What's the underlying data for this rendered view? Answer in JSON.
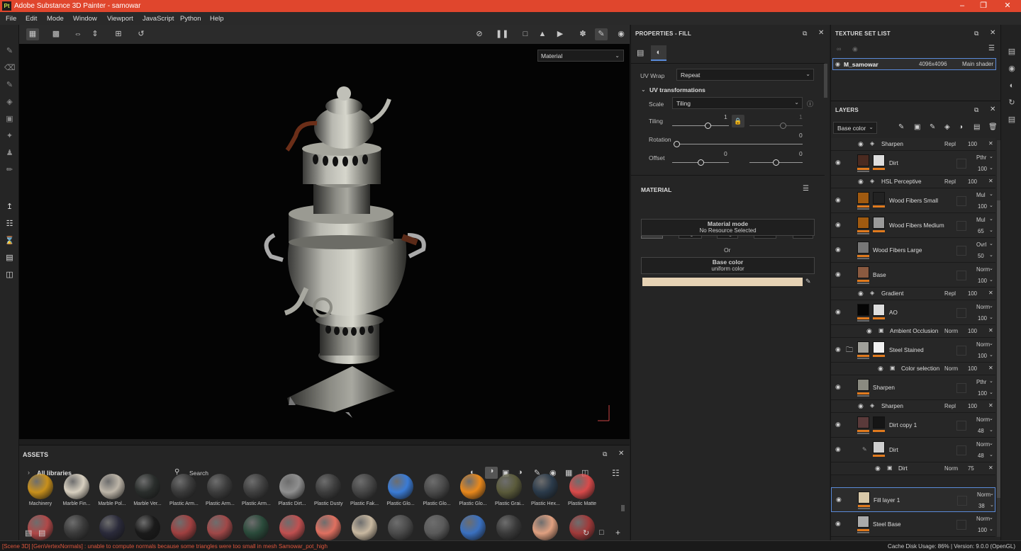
{
  "window": {
    "title": "Adobe Substance 3D Painter - samowar",
    "app_icon": "Pt"
  },
  "menu": [
    "File",
    "Edit",
    "Mode",
    "Window",
    "Viewport",
    "JavaScript",
    "Python",
    "Help"
  ],
  "viewport": {
    "mode_dropdown": "Material"
  },
  "properties": {
    "title": "PROPERTIES - FILL",
    "uv_wrap_label": "UV Wrap",
    "uv_wrap_value": "Repeat",
    "uv_transform_title": "UV transformations",
    "scale_label": "Scale",
    "scale_value": "Tiling",
    "tiling_label": "Tiling",
    "tiling_value": "1",
    "tiling_value2": "1",
    "rotation_label": "Rotation",
    "rotation_value": "0",
    "offset_label": "Offset",
    "offset_x": "0",
    "offset_y": "0",
    "material_title": "MATERIAL",
    "channels": [
      "color",
      "height",
      "rough",
      "metal",
      "nrm"
    ],
    "material_mode_title": "Material mode",
    "material_mode_sub": "No Resource Selected",
    "or_text": "Or",
    "base_color_title": "Base color",
    "base_color_sub": "uniform color",
    "base_color_swatch": "#e6d2b4"
  },
  "texture_set_list": {
    "title": "TEXTURE SET LIST",
    "item_name": "M_samowar",
    "item_res": "4096x4096",
    "item_shader": "Main shader"
  },
  "layers": {
    "title": "LAYERS",
    "channel_dropdown": "Base color",
    "rows": [
      {
        "name": "Sharpen",
        "blend": "Repl",
        "opacity": "100"
      },
      {
        "name": "Dirt",
        "blend": "Pthr",
        "opacity": "100"
      },
      {
        "name": "HSL Perceptive",
        "blend": "Repl",
        "opacity": "100"
      },
      {
        "name": "Wood Fibers Small",
        "blend": "Mul",
        "opacity": "100"
      },
      {
        "name": "Wood Fibers Medium",
        "blend": "Mul",
        "opacity": "65"
      },
      {
        "name": "Wood Fibers Large",
        "blend": "Ovrl",
        "opacity": "50"
      },
      {
        "name": "Base",
        "blend": "Norm",
        "opacity": "100"
      },
      {
        "name": "Gradient",
        "blend": "Repl",
        "opacity": "100"
      },
      {
        "name": "AO",
        "blend": "Norm",
        "opacity": "100"
      },
      {
        "name": "Ambient Occlusion",
        "blend": "Norm",
        "opacity": "100"
      },
      {
        "name": "Steel Stained",
        "blend": "Norm",
        "opacity": "100"
      },
      {
        "name": "Color selection",
        "blend": "Norm",
        "opacity": "100"
      },
      {
        "name": "Sharpen",
        "blend": "Pthr",
        "opacity": "100"
      },
      {
        "name": "Sharpen",
        "blend": "Repl",
        "opacity": "100"
      },
      {
        "name": "Dirt copy 1",
        "blend": "Norm",
        "opacity": "48"
      },
      {
        "name": "Dirt",
        "blend": "Norm",
        "opacity": "48"
      },
      {
        "name": "Dirt",
        "blend": "Norm",
        "opacity": "75"
      },
      {
        "name": "Fill layer 1",
        "blend": "Norm",
        "opacity": "38"
      },
      {
        "name": "Steel Base",
        "blend": "Norm",
        "opacity": "100"
      }
    ]
  },
  "assets": {
    "title": "ASSETS",
    "library": "All libraries",
    "search_placeholder": "Search",
    "materials": [
      "Machinery",
      "Marble Fin...",
      "Marble Pol...",
      "Marble Ver...",
      "Plastic Arm...",
      "Plastic Arm...",
      "Plastic Arm...",
      "Plastic Dirt...",
      "Plastic Dusty",
      "Plastic Fak...",
      "Plastic Glo...",
      "Plastic Glo...",
      "Plastic Glo...",
      "Plastic Grai...",
      "Plastic Hex...",
      "Plastic Matte"
    ],
    "material_colors": [
      "#c8901c",
      "#d8d0c0",
      "#bdb5a8",
      "#2a2e2c",
      "#3a3a3a",
      "#3c3c3c",
      "#3f3f3f",
      "#8f8f8f",
      "#3d3d3d",
      "#454545",
      "#3a7bd5",
      "#4a4a4a",
      "#e8881c",
      "#5a5a3a",
      "#2a3a4a",
      "#d84a4a"
    ],
    "row2_colors": [
      "#b04848",
      "#3a3a3a",
      "#2a2a3a",
      "#1a1a1a",
      "#a04040",
      "#a04848",
      "#2a4a3a",
      "#c05050",
      "#e07060",
      "#c8b8a0",
      "#4a4a4a",
      "#5a5a5a",
      "#3a70c0",
      "#3a3a3a",
      "#e0a080",
      "#a03a3a"
    ]
  },
  "status": {
    "error": "[Scene 3D] [GenVertexNormals] : unable to compute normals because some triangles were too small in mesh Samowar_pot_high",
    "cache": "Cache Disk Usage:   86% | Version: 9.0.0 (OpenGL)"
  }
}
